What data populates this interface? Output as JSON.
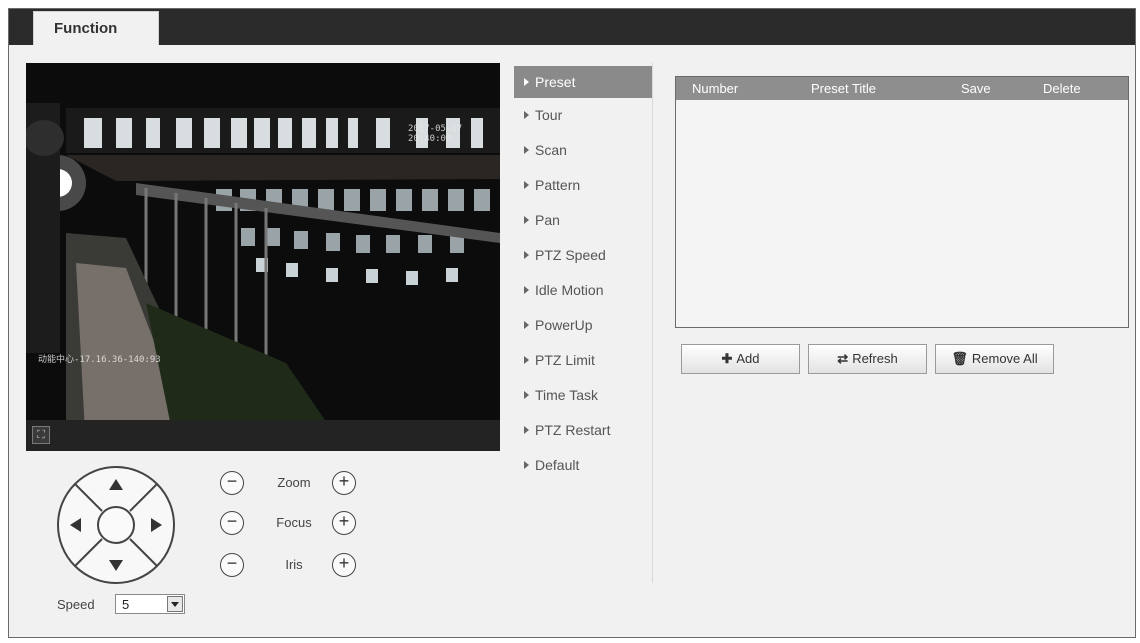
{
  "header": {
    "tab_label": "Function"
  },
  "video": {
    "osd_time": "2017-05-17 20:40:00",
    "osd_channel": "动能中心-17.16.36-140:93"
  },
  "menu": {
    "items": [
      {
        "label": "Preset",
        "active": true
      },
      {
        "label": "Tour"
      },
      {
        "label": "Scan"
      },
      {
        "label": "Pattern"
      },
      {
        "label": "Pan"
      },
      {
        "label": "PTZ Speed"
      },
      {
        "label": "Idle Motion"
      },
      {
        "label": "PowerUp"
      },
      {
        "label": "PTZ Limit"
      },
      {
        "label": "Time Task"
      },
      {
        "label": "PTZ Restart"
      },
      {
        "label": "Default"
      }
    ]
  },
  "table": {
    "columns": [
      "Number",
      "Preset Title",
      "Save",
      "Delete"
    ],
    "rows": []
  },
  "buttons": {
    "add": "Add",
    "refresh": "Refresh",
    "remove_all": "Remove All"
  },
  "ptz": {
    "zoom_label": "Zoom",
    "focus_label": "Focus",
    "iris_label": "Iris",
    "speed_label": "Speed",
    "speed_value": "5"
  },
  "colors": {
    "header_bar": "#2b2b2b",
    "menu_active": "#8a8a8a",
    "table_header": "#8e8e8e"
  }
}
